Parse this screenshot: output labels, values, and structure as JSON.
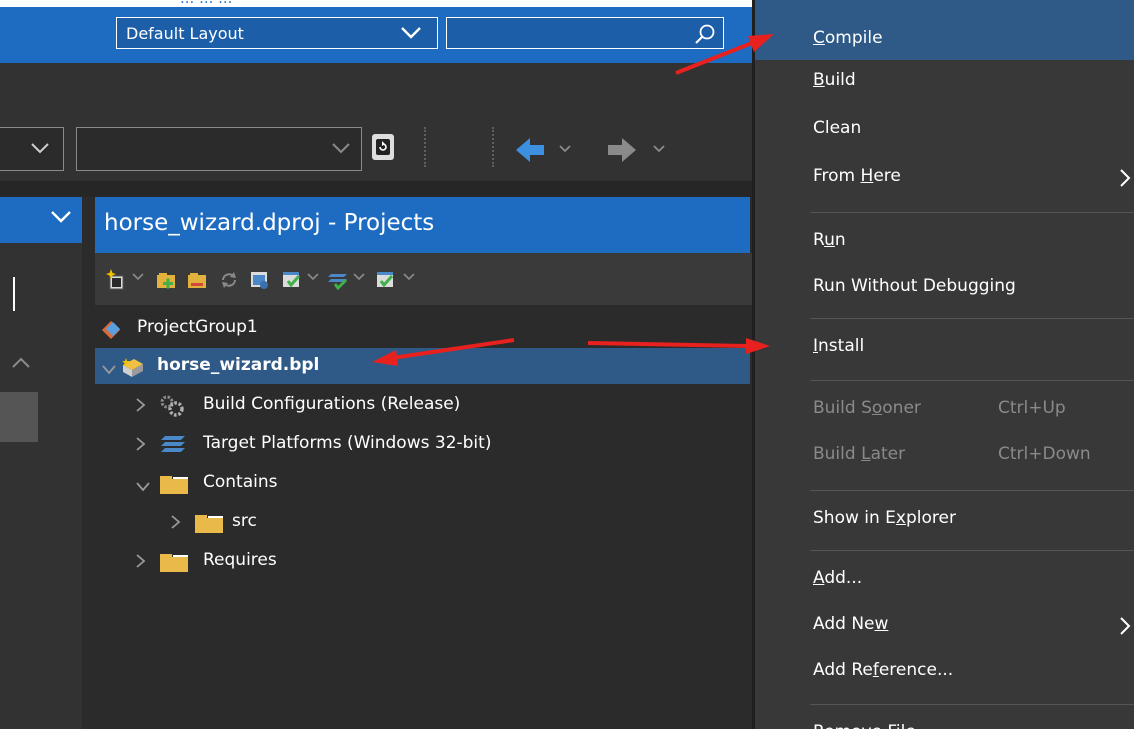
{
  "caption_partial": "...                                          ...                                    ...",
  "title_bar": {
    "layout_select": {
      "value": "Default Layout",
      "icon": "chevron-down-icon"
    },
    "search": {
      "placeholder": "",
      "icon": "search-icon"
    }
  },
  "toolbar": {
    "combo_a": {
      "value": "",
      "icon": "chevron-down-icon"
    },
    "combo_b": {
      "value": "",
      "icon": "chevron-down-icon"
    },
    "icons": [
      "refresh-device-icon",
      "back-arrow-icon",
      "forward-arrow-icon"
    ]
  },
  "projects_panel": {
    "title": "horse_wizard.dproj - Projects",
    "toolbar_icons": [
      "new-item-icon",
      "add-new-project-icon",
      "add-existing-project-icon",
      "sync-icon",
      "project-options-icon",
      "build-icon",
      "platforms-icon",
      "compile-check-icon"
    ],
    "tree": [
      {
        "label": "ProjectGroup1",
        "icon": "project-group-icon",
        "level": 0,
        "expander": "none",
        "selected": false,
        "bold": false
      },
      {
        "label": "horse_wizard.bpl",
        "icon": "package-icon",
        "level": 0,
        "expander": "expanded",
        "selected": true,
        "bold": true
      },
      {
        "label": "Build Configurations (Release)",
        "icon": "gear-icon",
        "level": 1,
        "expander": "collapsed",
        "selected": false,
        "bold": false
      },
      {
        "label": "Target Platforms (Windows 32-bit)",
        "icon": "platforms-icon",
        "level": 1,
        "expander": "collapsed",
        "selected": false,
        "bold": false
      },
      {
        "label": "Contains",
        "icon": "folder-icon",
        "level": 1,
        "expander": "expanded",
        "selected": false,
        "bold": false
      },
      {
        "label": "src",
        "icon": "folder-icon",
        "level": 2,
        "expander": "collapsed",
        "selected": false,
        "bold": false
      },
      {
        "label": "Requires",
        "icon": "folder-icon",
        "level": 1,
        "expander": "collapsed",
        "selected": false,
        "bold": false
      }
    ]
  },
  "context_menu": {
    "items": [
      {
        "label": "Compile",
        "accel": "C",
        "shortcut": "",
        "submenu": false,
        "disabled": false,
        "highlighted": true
      },
      {
        "label": "Build",
        "accel": "B",
        "shortcut": "",
        "submenu": false,
        "disabled": false,
        "highlighted": false
      },
      {
        "label": "Clean",
        "accel": "",
        "shortcut": "",
        "submenu": false,
        "disabled": false,
        "highlighted": false
      },
      {
        "label": "From Here",
        "accel": "H",
        "shortcut": "",
        "submenu": true,
        "disabled": false,
        "highlighted": false
      },
      {
        "separator": true
      },
      {
        "label": "Run",
        "accel": "u",
        "shortcut": "",
        "submenu": false,
        "disabled": false,
        "highlighted": false
      },
      {
        "label": "Run Without Debugging",
        "accel": "",
        "shortcut": "",
        "submenu": false,
        "disabled": false,
        "highlighted": false
      },
      {
        "separator": true
      },
      {
        "label": "Install",
        "accel": "I",
        "shortcut": "",
        "submenu": false,
        "disabled": false,
        "highlighted": false
      },
      {
        "separator": true
      },
      {
        "label": "Build Sooner",
        "accel": "o",
        "shortcut": "Ctrl+Up",
        "submenu": false,
        "disabled": true,
        "highlighted": false
      },
      {
        "label": "Build Later",
        "accel": "L",
        "shortcut": "Ctrl+Down",
        "submenu": false,
        "disabled": true,
        "highlighted": false
      },
      {
        "separator": true
      },
      {
        "label": "Show in Explorer",
        "accel": "x",
        "shortcut": "",
        "submenu": false,
        "disabled": false,
        "highlighted": false
      },
      {
        "separator": true
      },
      {
        "label": "Add...",
        "accel": "A",
        "shortcut": "",
        "submenu": false,
        "disabled": false,
        "highlighted": false
      },
      {
        "label": "Add New",
        "accel": "w",
        "shortcut": "",
        "submenu": true,
        "disabled": false,
        "highlighted": false
      },
      {
        "label": "Add Reference...",
        "accel": "f",
        "shortcut": "",
        "submenu": false,
        "disabled": false,
        "highlighted": false
      },
      {
        "separator": true
      },
      {
        "label": "Remove File...",
        "accel": "",
        "shortcut": "",
        "submenu": false,
        "disabled": false,
        "highlighted": false
      }
    ]
  },
  "annotations": {
    "arrow_color": "#e8211e"
  },
  "colors": {
    "accent_blue": "#1e6cc1",
    "selection": "#2f5a88",
    "menu_bg": "#383838",
    "panel_bg": "#2b2b2b"
  }
}
